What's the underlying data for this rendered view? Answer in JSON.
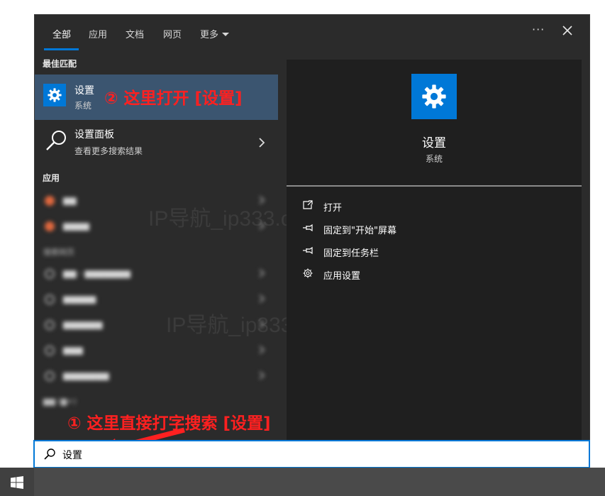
{
  "tabs": [
    {
      "label": "全部",
      "active": true
    },
    {
      "label": "应用",
      "active": false
    },
    {
      "label": "文档",
      "active": false
    },
    {
      "label": "网页",
      "active": false
    },
    {
      "label": "更多",
      "active": false
    }
  ],
  "window_controls": {
    "more": "···",
    "close": "×"
  },
  "left": {
    "best_match_header": "最佳匹配",
    "best_match": {
      "title": "设置",
      "subtitle": "系统",
      "icon": "gear-icon"
    },
    "control_panel": {
      "title": "设置面板",
      "subtitle": "查看更多搜索结果",
      "icon": "search-icon"
    },
    "apps_header": "应用",
    "blurred_web_header": "搜索网页"
  },
  "right": {
    "title": "设置",
    "subtitle": "系统",
    "actions": [
      {
        "label": "打开",
        "icon": "open-icon"
      },
      {
        "label": "固定到\"开始\"屏幕",
        "icon": "pin-icon"
      },
      {
        "label": "固定到任务栏",
        "icon": "pin-icon"
      },
      {
        "label": "应用设置",
        "icon": "gear-icon"
      }
    ]
  },
  "search": {
    "value": "设置",
    "icon": "search-icon"
  },
  "annotations": {
    "step2": "② 这里打开 [设置]",
    "step1": "① 这里直接打字搜索 [设置]"
  },
  "watermark": "IP导航_ip333.cn",
  "colors": {
    "accent": "#0078d7",
    "annotation": "#ff2020",
    "highlight": "#3b5570"
  }
}
